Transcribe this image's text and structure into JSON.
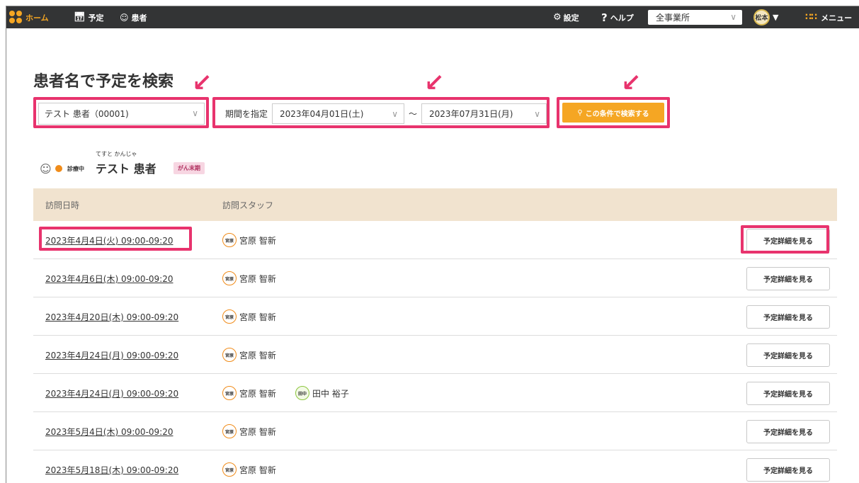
{
  "topbar": {
    "home_label": "ホーム",
    "schedule_label": "予定",
    "patient_label": "患者",
    "settings_label": "設定",
    "help_label": "ヘルプ",
    "office": "全事業所",
    "user_initials": "松本",
    "menu_label": "メニュー",
    "accent": "#f5a623"
  },
  "page": {
    "title": "患者名で予定を検索"
  },
  "search": {
    "patient_value": "テスト 患者（00001)",
    "period_label": "期間を指定",
    "start_date": "2023年04月01日(土)",
    "end_date": "2023年07月31日(月)",
    "tilde": "〜",
    "search_button": "この条件で検索する"
  },
  "patient": {
    "status": "診療中",
    "furigana": "てすと かんじゃ",
    "name": "テスト 患者",
    "tag": "がん末期",
    "status_color": "#f08c1a"
  },
  "table": {
    "headers": {
      "date": "訪問日時",
      "staff": "訪問スタッフ"
    },
    "detail_button": "予定詳細を見る",
    "rows": [
      {
        "date": "2023年4月4日(火) 09:00-09:20",
        "staff": [
          {
            "badge": "宮原",
            "name": "宮原 智新"
          }
        ]
      },
      {
        "date": "2023年4月6日(木) 09:00-09:20",
        "staff": [
          {
            "badge": "宮原",
            "name": "宮原 智新"
          }
        ]
      },
      {
        "date": "2023年4月20日(木) 09:00-09:20",
        "staff": [
          {
            "badge": "宮原",
            "name": "宮原 智新"
          }
        ]
      },
      {
        "date": "2023年4月24日(月) 09:00-09:20",
        "staff": [
          {
            "badge": "宮原",
            "name": "宮原 智新"
          }
        ]
      },
      {
        "date": "2023年4月24日(月) 09:00-09:20",
        "staff": [
          {
            "badge": "宮原",
            "name": "宮原 智新"
          },
          {
            "badge": "田中",
            "name": "田中 裕子"
          }
        ]
      },
      {
        "date": "2023年5月4日(木) 09:00-09:20",
        "staff": [
          {
            "badge": "宮原",
            "name": "宮原 智新"
          }
        ]
      },
      {
        "date": "2023年5月18日(木) 09:00-09:20",
        "staff": [
          {
            "badge": "宮原",
            "name": "宮原 智新"
          }
        ]
      }
    ]
  },
  "highlight_color": "#e8336d"
}
